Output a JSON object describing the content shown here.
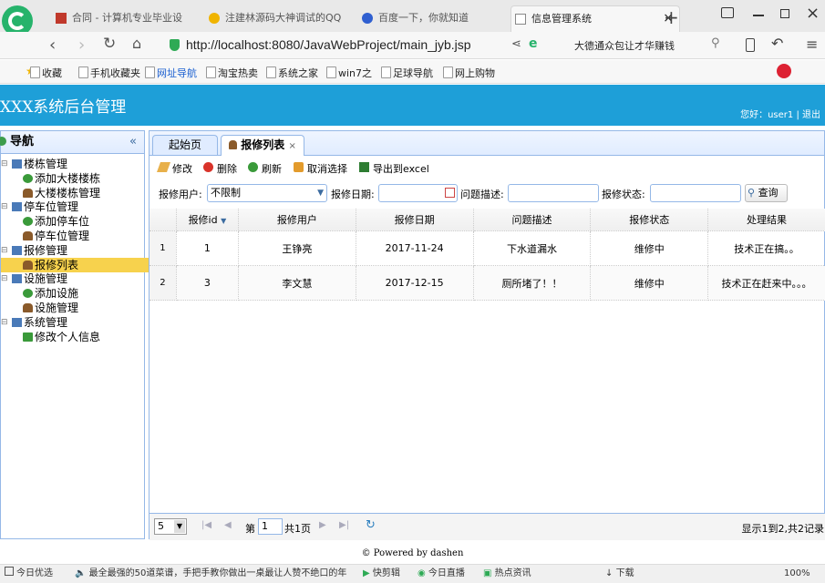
{
  "browser": {
    "tabs": [
      {
        "title": "合同 - 计算机专业毕业设",
        "active": false
      },
      {
        "title": "注建林源码大神调试的QQ",
        "active": false
      },
      {
        "title": "百度一下，你就知道",
        "active": false
      },
      {
        "title": "信息管理系统",
        "active": true
      }
    ],
    "url": "http://localhost:8080/JavaWebProject/main_jyb.jsp",
    "search_text": "大德通众包让才华赚钱",
    "bookmarks": [
      "收藏",
      "手机收藏夹",
      "网址导航",
      "淘宝热卖",
      "系统之家",
      "win7之",
      "足球导航",
      "网上购物"
    ]
  },
  "app": {
    "title": "XXX系统后台管理",
    "welcome": "您好：user1 | 退出"
  },
  "sidebar": {
    "title": "导航",
    "collapse_glyph": "«",
    "tree": [
      {
        "label": "楼栋管理",
        "level": 0
      },
      {
        "label": "添加大楼楼栋",
        "level": 1
      },
      {
        "label": "大楼楼栋管理",
        "level": 1
      },
      {
        "label": "停车位管理",
        "level": 0
      },
      {
        "label": "添加停车位",
        "level": 1
      },
      {
        "label": "停车位管理",
        "level": 1
      },
      {
        "label": "报修管理",
        "level": 0
      },
      {
        "label": "报修列表",
        "level": 1,
        "selected": true
      },
      {
        "label": "设施管理",
        "level": 0
      },
      {
        "label": "添加设施",
        "level": 1
      },
      {
        "label": "设施管理",
        "level": 1
      },
      {
        "label": "系统管理",
        "level": 0
      },
      {
        "label": "修改个人信息",
        "level": 1
      }
    ]
  },
  "main": {
    "tabs": [
      {
        "label": "起始页"
      },
      {
        "label": "报修列表",
        "close": "×"
      }
    ],
    "toolbar": {
      "edit": "修改",
      "delete": "删除",
      "refresh": "刷新",
      "cancel": "取消选择",
      "export": "导出到excel"
    },
    "search": {
      "user_label": "报修用户:",
      "user_value": "不限制",
      "date_label": "报修日期:",
      "desc_label": "问题描述:",
      "state_label": "报修状态:",
      "query_button": "查询"
    },
    "grid": {
      "columns": [
        "报修id",
        "报修用户",
        "报修日期",
        "问题描述",
        "报修状态",
        "处理结果"
      ],
      "rows": [
        {
          "rownum": "1",
          "cells": [
            "1",
            "王铮亮",
            "2017-11-24",
            "下水道漏水",
            "维修中",
            "技术正在搞。。"
          ]
        },
        {
          "rownum": "2",
          "cells": [
            "3",
            "李文慧",
            "2017-12-15",
            "厕所堵了！！",
            "维修中",
            "技术正在赶来中。。。"
          ]
        }
      ]
    },
    "pager": {
      "page_size": "5",
      "page_prefix": "第",
      "page_value": "1",
      "page_suffix": "共1页",
      "summary": "显示1到2,共2记录"
    }
  },
  "footer": "© Powered by dashen",
  "statusbar": {
    "item1": "今日优选",
    "news": "最全最强的50道菜谱，手把手教你做出一桌最让人赞不绝口的年",
    "item2": "快剪辑",
    "item3": "今日直播",
    "item4": "热点资讯",
    "download": "下载",
    "zoom": "100%"
  },
  "colors": {
    "header_blue": "#1e9fd8",
    "panel_border": "#95b8e7",
    "selected_yellow": "#f7d24d"
  }
}
